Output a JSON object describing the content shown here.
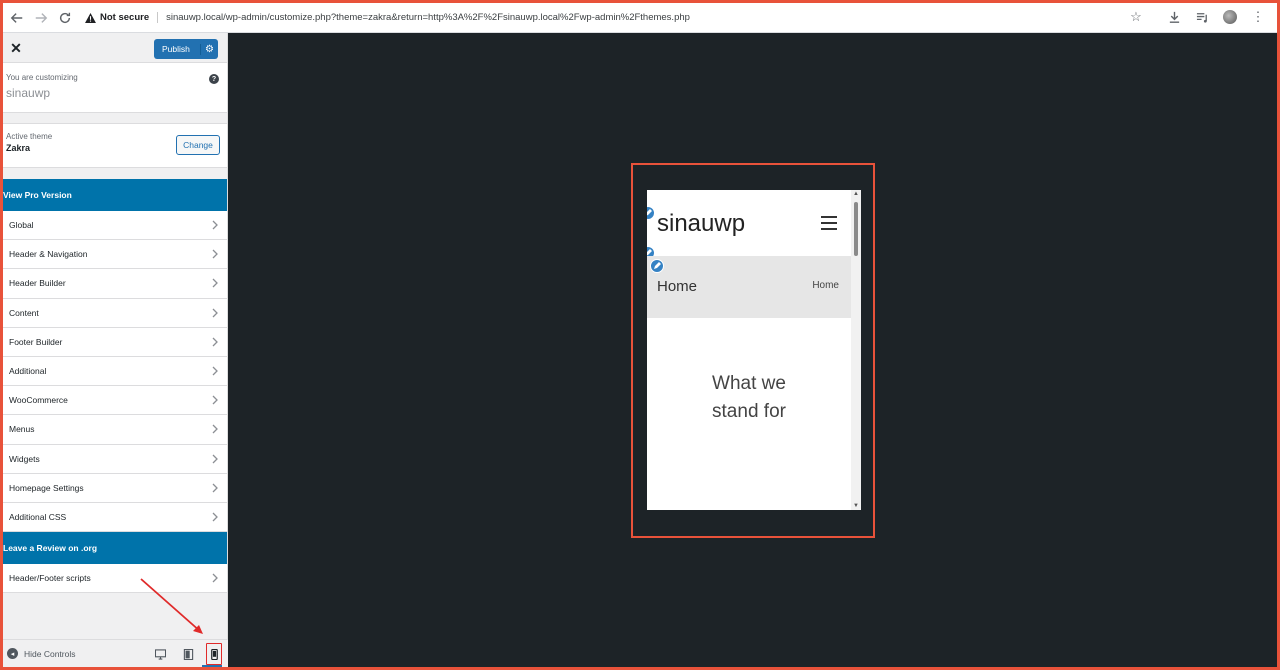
{
  "browser": {
    "security_label": "Not secure",
    "url": "sinauwp.local/wp-admin/customize.php?theme=zakra&return=http%3A%2F%2Fsinauwp.local%2Fwp-admin%2Fthemes.php"
  },
  "sidebar": {
    "publish_label": "Publish",
    "customizing_label": "You are customizing",
    "site_name": "sinauwp",
    "active_theme_label": "Active theme",
    "theme_name": "Zakra",
    "change_label": "Change",
    "promo_top": "View Pro Version",
    "items": [
      {
        "label": "Global"
      },
      {
        "label": "Header & Navigation"
      },
      {
        "label": "Header Builder"
      },
      {
        "label": "Content"
      },
      {
        "label": "Footer Builder"
      },
      {
        "label": "Additional"
      },
      {
        "label": "WooCommerce"
      },
      {
        "label": "Menus"
      },
      {
        "label": "Widgets"
      },
      {
        "label": "Homepage Settings"
      },
      {
        "label": "Additional CSS"
      }
    ],
    "promo_review": "Leave a Review on .org",
    "scripts_item": "Header/Footer scripts",
    "hide_controls": "Hide Controls",
    "active_device": "mobile"
  },
  "preview": {
    "site_title": "sinauwp",
    "page_title": "Home",
    "breadcrumb": "Home",
    "heading": "What we stand for"
  },
  "colors": {
    "accent": "#2271b1",
    "promo": "#0073aa",
    "annotation": "#e8523a"
  }
}
